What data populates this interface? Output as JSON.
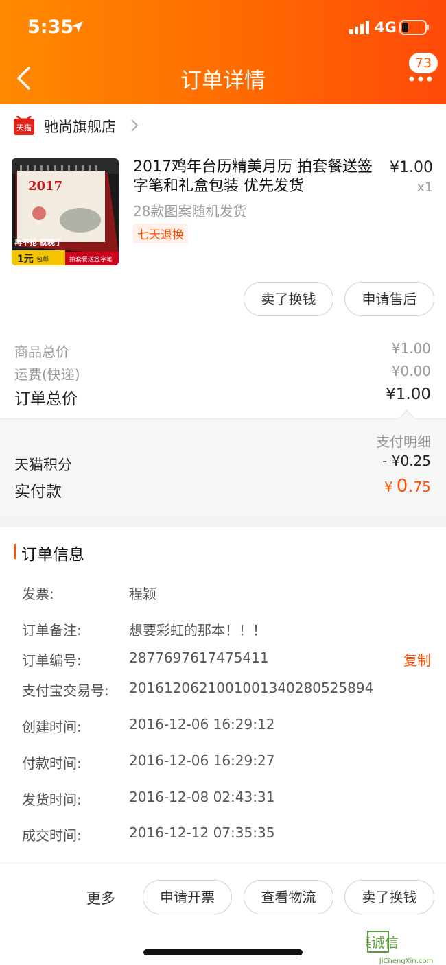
{
  "status": {
    "time": "5:35",
    "network": "4G"
  },
  "header": {
    "title": "订单详情",
    "badge_count": "73"
  },
  "store": {
    "logo_text": "天猫",
    "name": "驰尚旗舰店"
  },
  "product": {
    "title": "2017鸡年台历精美月历  拍套餐送签字笔和礼盒包装 优先发货",
    "sku": "28款图案随机发货",
    "tag": "七天退换",
    "price": "¥1.00",
    "qty": "x1",
    "image_texts": {
      "year": "2017",
      "slogan": "再不抢  就晚了",
      "promo": "1元",
      "promo_sub": "包邮",
      "bottom_banner": "拍套餐送签字笔"
    }
  },
  "item_actions": {
    "sell": "卖了换钱",
    "after_sale": "申请售后"
  },
  "summary": {
    "goods_label": "商品总价",
    "goods_value": "¥1.00",
    "freight_label": "运费(快递)",
    "freight_value": "¥0.00",
    "total_label": "订单总价",
    "total_value": "¥1.00"
  },
  "payment": {
    "detail_link": "支付明细",
    "points_label": "天猫积分",
    "points_value": "- ¥0.25",
    "paid_label": "实付款",
    "paid_currency": "¥",
    "paid_integer": "0.",
    "paid_decimal": "75"
  },
  "order_info": {
    "title": "订单信息",
    "rows": [
      {
        "label": "发票:",
        "value": "程颖"
      },
      {
        "label": "订单备注:",
        "value": "想要彩虹的那本！！！"
      },
      {
        "label": "订单编号:",
        "value": "2877697617475411"
      },
      {
        "label": "支付宝交易号:",
        "value": "2016120621001001340280525894"
      },
      {
        "label": "创建时间:",
        "value": "2016-12-06 16:29:12"
      },
      {
        "label": "付款时间:",
        "value": "2016-12-06 16:29:27"
      },
      {
        "label": "发货时间:",
        "value": "2016-12-08 02:43:31"
      },
      {
        "label": "成交时间:",
        "value": "2016-12-12 07:35:35"
      }
    ],
    "copy_label": "复制"
  },
  "bottom_bar": {
    "more": "更多",
    "invoice": "申请开票",
    "logistics": "查看物流",
    "sell": "卖了换钱"
  },
  "watermark": {
    "cn": "集诚信",
    "url": "JiChengXin.com"
  },
  "colors": {
    "accent": "#ff5000",
    "header_start": "#ff8a00",
    "header_end": "#ff4a0a"
  }
}
